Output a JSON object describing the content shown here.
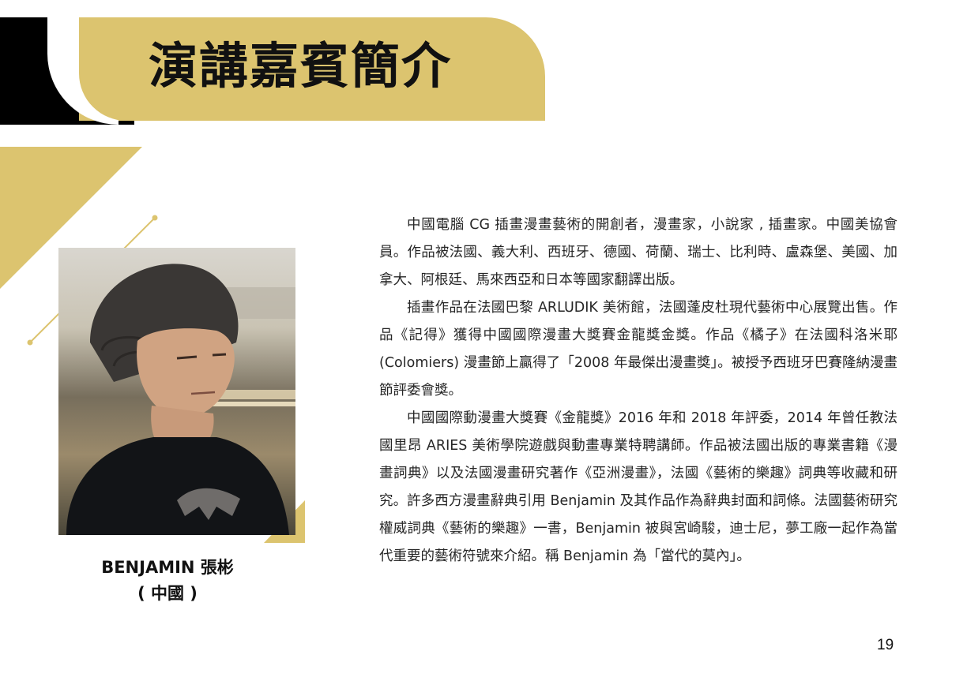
{
  "header": {
    "title": "演講嘉賓簡介"
  },
  "colors": {
    "accent_gold": "#dcc46f",
    "black": "#000000"
  },
  "speaker": {
    "photo": "speaker-portrait",
    "name": "BENJAMIN 張彬",
    "country": "( 中國 )"
  },
  "bio": {
    "paragraphs": [
      "中國電腦 CG 插畫漫畫藝術的開創者，漫畫家，小說家 , 插畫家。中國美協會員。作品被法國、義大利、西班牙、德國、荷蘭、瑞士、比利時、盧森堡、美國、加拿大、阿根廷、馬來西亞和日本等國家翻譯出版。",
      "插畫作品在法國巴黎 ARLUDIK 美術館，法國蓬皮杜現代藝術中心展覽出售。作品《記得》獲得中國國際漫畫大獎賽金龍獎金獎。作品《橘子》在法國科洛米耶 (Colomiers) 漫畫節上贏得了「2008 年最傑出漫畫獎」。被授予西班牙巴賽隆納漫畫節評委會獎。",
      "中國國際動漫畫大獎賽《金龍獎》2016 年和 2018 年評委，2014 年曾任教法國里昂 ARIES 美術學院遊戲與動畫專業特聘講師。作品被法國出版的專業書籍《漫畫詞典》以及法國漫畫研究著作《亞洲漫畫》，法國《藝術的樂趣》詞典等收藏和研究。許多西方漫畫辭典引用 Benjamin 及其作品作為辭典封面和詞條。法國藝術研究權威詞典《藝術的樂趣》一書，Benjamin 被與宮崎駿，迪士尼，夢工廠一起作為當代重要的藝術符號來介紹。稱 Benjamin 為「當代的莫內」。"
    ]
  },
  "page_number": "19"
}
